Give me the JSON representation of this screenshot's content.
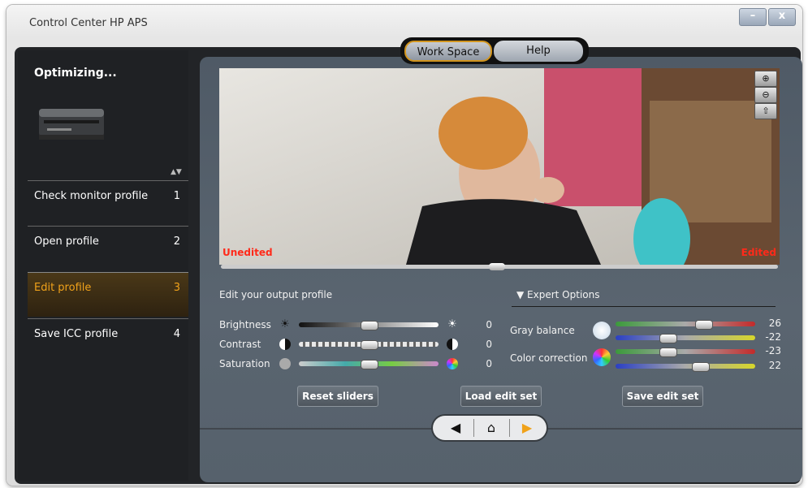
{
  "window": {
    "title": "Control Center HP APS",
    "minimize": "–",
    "close": "x"
  },
  "tabs": {
    "workspace": "Work Space",
    "help": "Help"
  },
  "sidebar": {
    "status": "Optimizing...",
    "steps": [
      {
        "label": "Check monitor profile",
        "number": "1"
      },
      {
        "label": "Open profile",
        "number": "2"
      },
      {
        "label": "Edit profile",
        "number": "3"
      },
      {
        "label": "Save ICC profile",
        "number": "4"
      }
    ]
  },
  "preview": {
    "unedited": "Unedited",
    "edited": "Edited"
  },
  "edit": {
    "heading": "Edit your output profile",
    "brightness": {
      "label": "Brightness",
      "value": "0"
    },
    "contrast": {
      "label": "Contrast",
      "value": "0"
    },
    "saturation": {
      "label": "Saturation",
      "value": "0"
    }
  },
  "expert": {
    "heading": "Expert Options",
    "gray_balance": {
      "label": "Gray balance",
      "value1": "26",
      "value2": "-22"
    },
    "color_correction": {
      "label": "Color correction",
      "value1": "-23",
      "value2": "22"
    }
  },
  "buttons": {
    "reset": "Reset sliders",
    "load": "Load edit set",
    "save": "Save edit set"
  },
  "colors": {
    "accent": "#f0a21a",
    "corner_label": "#ff2a1a"
  }
}
